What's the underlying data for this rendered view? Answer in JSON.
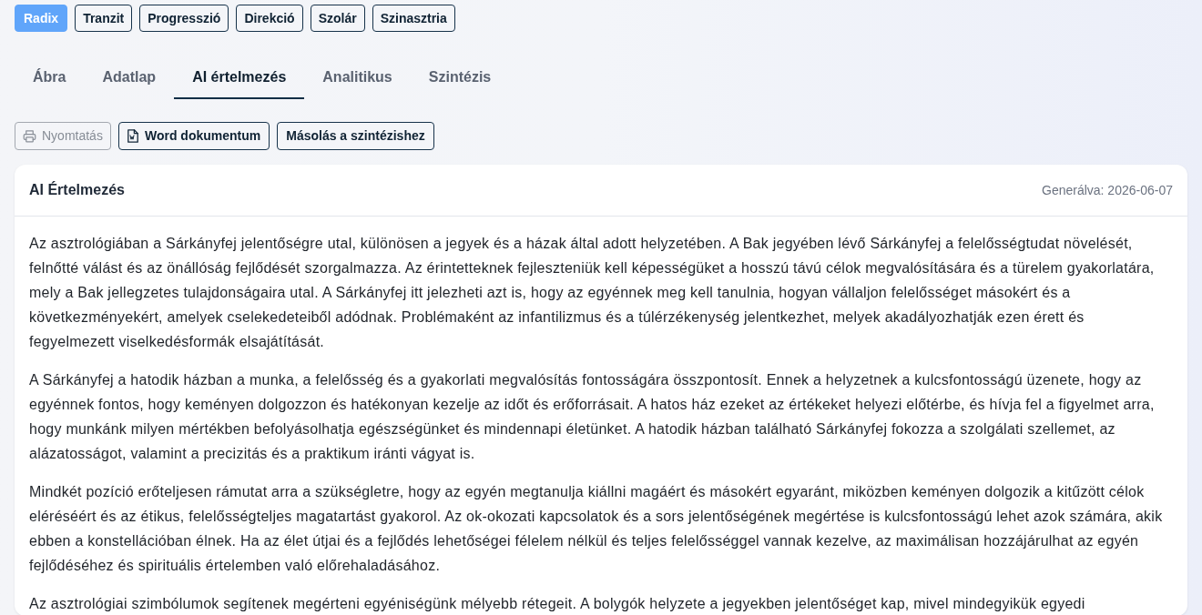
{
  "chart_modes": [
    {
      "label": "Radix",
      "selected": true
    },
    {
      "label": "Tranzit",
      "selected": false
    },
    {
      "label": "Progresszió",
      "selected": false
    },
    {
      "label": "Direkció",
      "selected": false
    },
    {
      "label": "Szolár",
      "selected": false
    },
    {
      "label": "Szinasztria",
      "selected": false
    }
  ],
  "tabs": [
    {
      "label": "Ábra",
      "selected": false
    },
    {
      "label": "Adatlap",
      "selected": false
    },
    {
      "label": "AI értelmezés",
      "selected": true
    },
    {
      "label": "Analitikus",
      "selected": false
    },
    {
      "label": "Szintézis",
      "selected": false
    }
  ],
  "actions": [
    {
      "kind": "print",
      "label": "Nyomtatás",
      "disabled": true
    },
    {
      "kind": "word",
      "label": "Word dokumentum",
      "disabled": false
    },
    {
      "kind": "copy",
      "label": "Másolás a szintézishez",
      "disabled": false
    }
  ],
  "card": {
    "title": "AI Értelmezés",
    "generated": "Generálva: 2026-06-07",
    "paragraphs": [
      "Az asztrológiában a Sárkányfej jelentőségre utal, különösen a jegyek és a házak által adott helyzetében. A Bak jegyében lévő Sárkányfej a felelősségtudat növelését, felnőtté válást és az önállóság fejlődését szorgalmazza. Az érintetteknek fejleszteniük kell képességüket a hosszú távú célok megvalósítására és a türelem gyakorlatára, mely a Bak jellegzetes tulajdonságaira utal. A Sárkányfej itt jelezheti azt is, hogy az egyénnek meg kell tanulnia, hogyan vállaljon felelősséget másokért és a következményekért, amelyek cselekedeteiből adódnak. Problémaként az infantilizmus és a túlérzékenység jelentkezhet, melyek akadályozhatják ezen érett és fegyelmezett viselkedésformák elsajátítását.",
      "A Sárkányfej a hatodik házban a munka, a felelősség és a gyakorlati megvalósítás fontosságára összpontosít. Ennek a helyzetnek a kulcsfontosságú üzenete, hogy az egyénnek fontos, hogy keményen dolgozzon és hatékonyan kezelje az időt és erőforrásait. A hatos ház ezeket az értékeket helyezi előtérbe, és hívja fel a figyelmet arra, hogy munkánk milyen mértékben befolyásolhatja egészségünket és mindennapi életünket. A hatodik házban található Sárkányfej fokozza a szolgálati szellemet, az alázatosságot, valamint a precizitás és a praktikum iránti vágyat is.",
      "Mindkét pozíció erőteljesen rámutat arra a szükségletre, hogy az egyén megtanulja kiállni magáért és másokért egyaránt, miközben keményen dolgozik a kitűzött célok eléréséért és az étikus, felelősségteljes magatartást gyakorol. Az ok-okozati kapcsolatok és a sors jelentőségének megértése is kulcsfontosságú lehet azok számára, akik ebben a konstellációban élnek. Ha az élet útjai és a fejlődés lehetőségei félelem nélkül és teljes felelősséggel vannak kezelve, az maximálisan hozzájárulhat az egyén fejlődéséhez és spirituális értelemben való előrehaladásához.",
      "Az asztrológiai szimbólumok segítenek megérteni egyéniségünk mélyebb rétegeit. A bolygók helyzete a jegyekben jelentőséget kap, mivel mindegyikük egyedi"
    ]
  }
}
